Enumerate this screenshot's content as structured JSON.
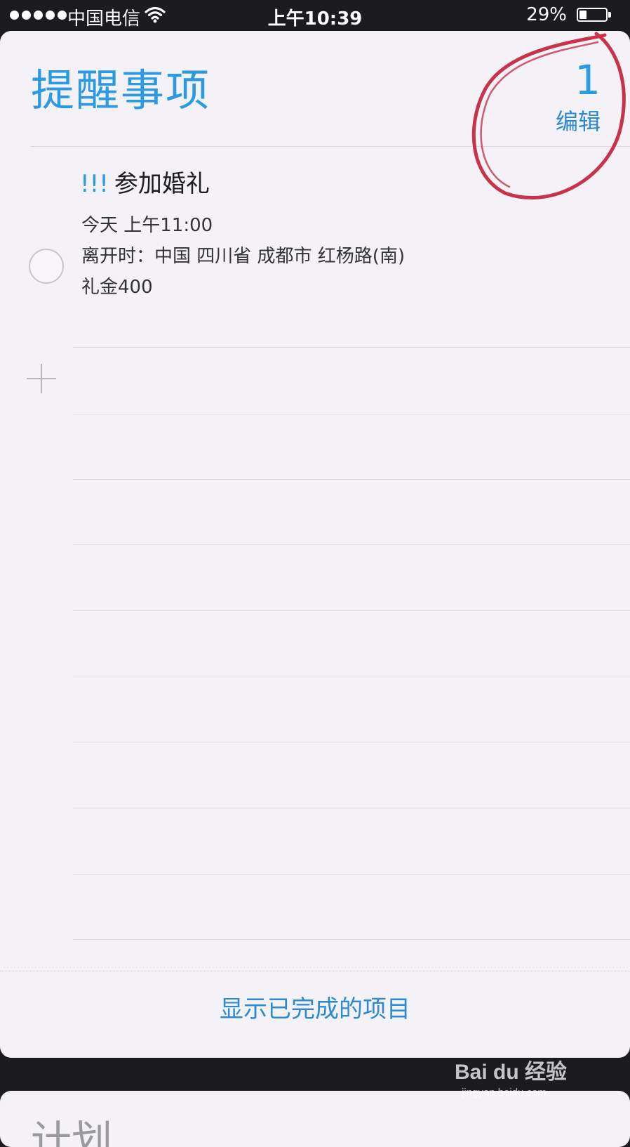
{
  "status_bar": {
    "carrier": "中国电信",
    "time": "上午10:39",
    "battery_percent": "29%",
    "battery_level": 0.29,
    "signal_dots": 5,
    "wifi_icon": "wifi-icon"
  },
  "list": {
    "title": "提醒事项",
    "count": "1",
    "edit_label": "编辑",
    "accent_color": "#2c9ae0"
  },
  "reminders": [
    {
      "priority": "!!!",
      "title": "参加婚礼",
      "due": "今天 上午11:00",
      "location": "离开时：中国 四川省 成都市 红杨路(南)",
      "note": "礼金400"
    }
  ],
  "footer": {
    "show_completed_label": "显示已完成的项目"
  },
  "next_list": {
    "title": "计划"
  },
  "watermark": {
    "brand": "Bai du 经验",
    "url": "jingyan.baidu.com"
  },
  "annotation_color": "#c8324a"
}
